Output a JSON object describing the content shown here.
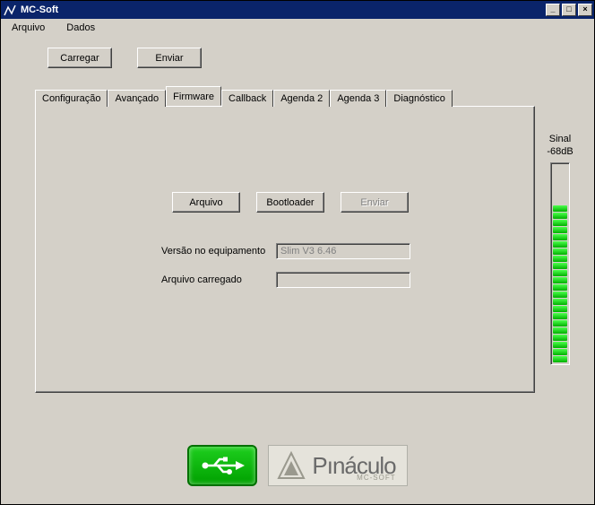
{
  "window": {
    "title": "MC-Soft"
  },
  "menu": {
    "arquivo": "Arquivo",
    "dados": "Dados"
  },
  "toolbar": {
    "carregar": "Carregar",
    "enviar": "Enviar"
  },
  "tabs": {
    "configuracao": "Configuração",
    "avancado": "Avançado",
    "firmware": "Firmware",
    "callback": "Callback",
    "agenda2": "Agenda 2",
    "agenda3": "Agenda 3",
    "diagnostico": "Diagnóstico"
  },
  "firmware": {
    "arquivo_btn": "Arquivo",
    "bootloader_btn": "Bootloader",
    "enviar_btn": "Enviar",
    "versao_label": "Versão no equipamento",
    "versao_value": "Slim V3 6.46",
    "arquivo_label": "Arquivo carregado",
    "arquivo_value": ""
  },
  "signal": {
    "label": "Sinal",
    "value": "-68dB",
    "segments": 22
  },
  "brand": {
    "name": "Pınáculo",
    "sub": "MC-SOFT"
  },
  "titlebar_buttons": {
    "min": "_",
    "max": "□",
    "close": "×"
  }
}
